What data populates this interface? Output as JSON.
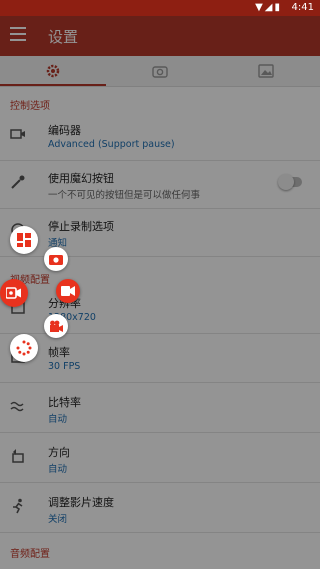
{
  "status_bar": {
    "time": "4:41",
    "icons": [
      "wifi-icon",
      "signal-icon",
      "battery-icon"
    ]
  },
  "app_bar": {
    "title": "设置",
    "menu_icon": "hamburger-menu-icon"
  },
  "tabs": [
    {
      "icon": "gear-icon",
      "active": true
    },
    {
      "icon": "camera-icon",
      "active": false
    },
    {
      "icon": "image-icon",
      "active": false
    }
  ],
  "sections": {
    "control": "控制选项",
    "video": "视频配置",
    "audio": "音频配置"
  },
  "settings": {
    "encoder": {
      "title": "编码器",
      "value": "Advanced (Support pause)"
    },
    "magic_button": {
      "title": "使用魔幻按钮",
      "value": "一个不可见的按钮但是可以做任何事",
      "enabled": false
    },
    "stop_record": {
      "title": "停止录制选项",
      "value": "通知"
    },
    "resolution": {
      "title": "分辨率",
      "value": "1280x720"
    },
    "frame_rate": {
      "title": "帧率",
      "value": "30 FPS"
    },
    "bitrate": {
      "title": "比特率",
      "value": "自动"
    },
    "orientation": {
      "title": "方向",
      "value": "自动"
    },
    "speed": {
      "title": "调整影片速度",
      "value": "关闭"
    }
  },
  "floating_menu": [
    "dashboard-icon",
    "camera-icon",
    "record-video-icon",
    "stop-record-icon",
    "video-camera-icon",
    "brush-tools-icon"
  ],
  "colors": {
    "accent": "#b3382a",
    "status_bar": "#8e1f12",
    "link": "#1f6fb2",
    "fab_red": "#e8321e"
  }
}
